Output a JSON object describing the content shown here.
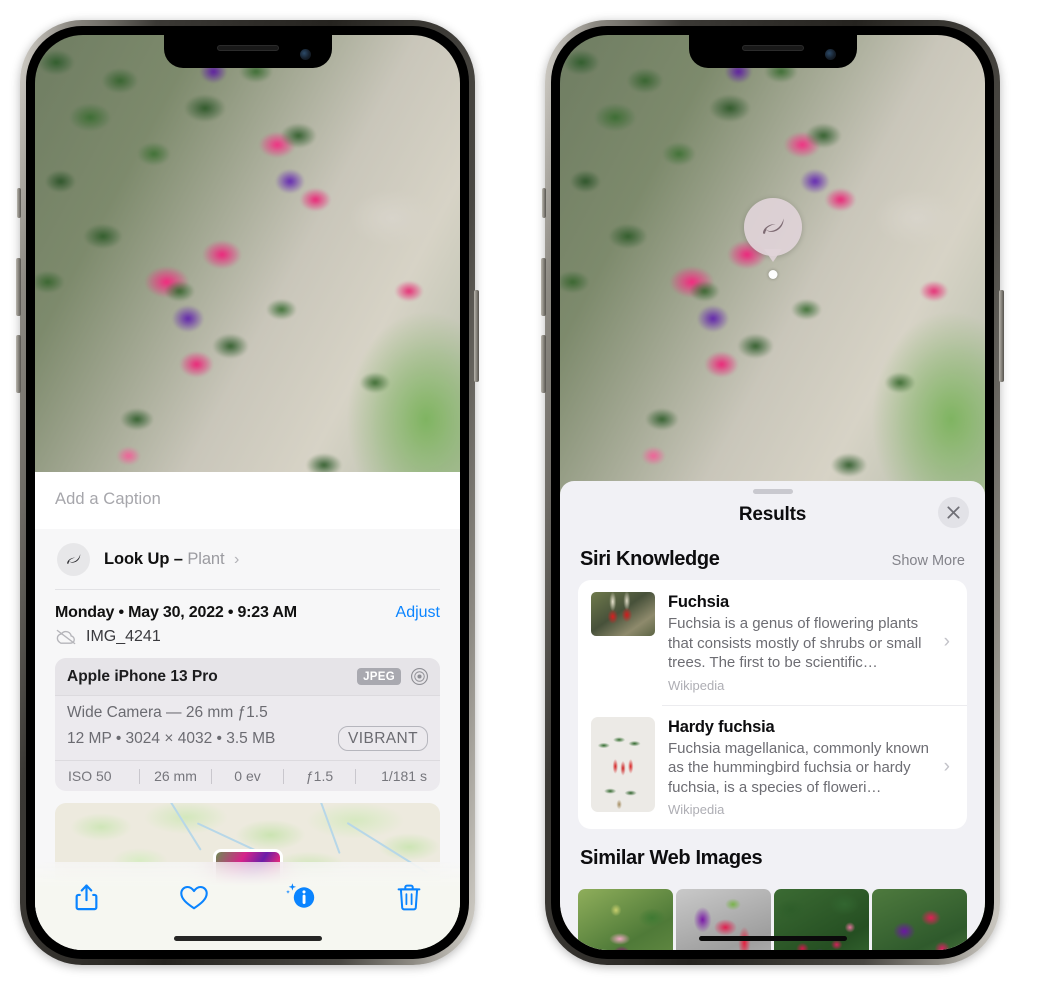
{
  "left_phone": {
    "caption_placeholder": "Add a Caption",
    "lookup": {
      "label": "Look Up",
      "dash": "–",
      "subject": "Plant",
      "chevron": "›",
      "icon": "leaf-icon"
    },
    "meta": {
      "date": "Monday • May 30, 2022 • 9:23 AM",
      "adjust_label": "Adjust",
      "file_name": "IMG_4241",
      "cloud_icon": "icloud-slash-icon"
    },
    "exif": {
      "device": "Apple iPhone 13 Pro",
      "format_badge": "JPEG",
      "lens_icon": "aperture-icon",
      "lens_line": "Wide Camera — 26 mm ƒ1.5",
      "detail_line": "12 MP • 3024 × 4032 • 3.5 MB",
      "style_badge": "VIBRANT",
      "settings": [
        "ISO 50",
        "26 mm",
        "0 ev",
        "ƒ1.5",
        "1/181 s"
      ]
    },
    "toolbar": [
      {
        "name": "share-button",
        "icon": "share-icon"
      },
      {
        "name": "favorite-button",
        "icon": "heart-icon"
      },
      {
        "name": "info-button",
        "icon": "info-sparkle-icon"
      },
      {
        "name": "delete-button",
        "icon": "trash-icon"
      }
    ],
    "accent_color": "#0a84ff"
  },
  "right_phone": {
    "visual_lookup_badge": {
      "icon": "leaf-icon"
    },
    "sheet": {
      "title": "Results",
      "close_icon": "close-icon",
      "sections": [
        {
          "title": "Siri Knowledge",
          "action": "Show More",
          "items": [
            {
              "title": "Fuchsia",
              "description": "Fuchsia is a genus of flowering plants that consists mostly of shrubs or small trees. The first to be scientific…",
              "source": "Wikipedia",
              "chevron": "›"
            },
            {
              "title": "Hardy fuchsia",
              "description": "Fuchsia magellanica, commonly known as the hummingbird fuchsia or hardy fuchsia, is a species of floweri…",
              "source": "Wikipedia",
              "chevron": "›"
            }
          ]
        },
        {
          "title": "Similar Web Images",
          "thumbnails": [
            "fuchsia-web-image-1",
            "fuchsia-web-image-2",
            "fuchsia-web-image-3",
            "fuchsia-web-image-4"
          ]
        }
      ]
    }
  }
}
